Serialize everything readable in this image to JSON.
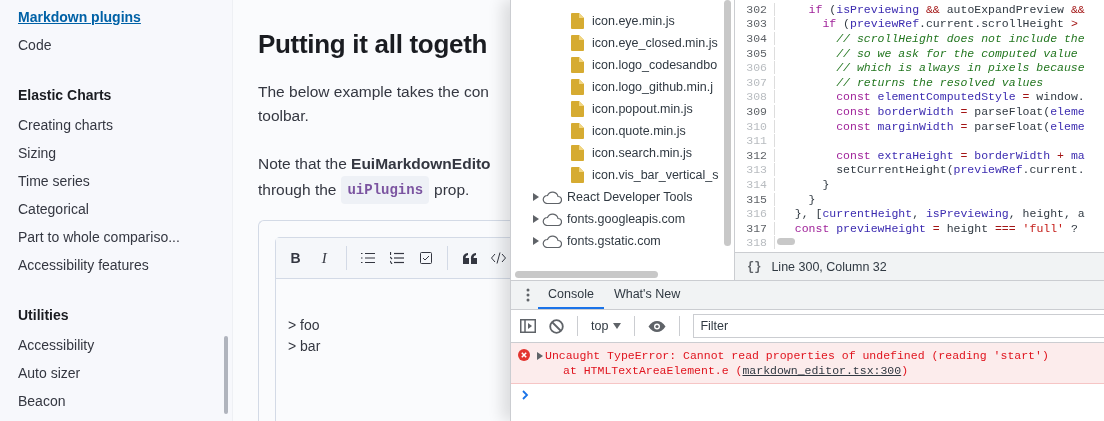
{
  "sidebar": {
    "items": [
      {
        "kind": "item",
        "label": "Markdown plugins",
        "selected": true
      },
      {
        "kind": "item",
        "label": "Code",
        "selected": false
      },
      {
        "kind": "heading",
        "label": "Elastic Charts"
      },
      {
        "kind": "item",
        "label": "Creating charts",
        "selected": false
      },
      {
        "kind": "item",
        "label": "Sizing",
        "selected": false
      },
      {
        "kind": "item",
        "label": "Time series",
        "selected": false
      },
      {
        "kind": "item",
        "label": "Categorical",
        "selected": false
      },
      {
        "kind": "item",
        "label": "Part to whole compariso...",
        "selected": false
      },
      {
        "kind": "item",
        "label": "Accessibility features",
        "selected": false
      },
      {
        "kind": "heading",
        "label": "Utilities"
      },
      {
        "kind": "item",
        "label": "Accessibility",
        "selected": false
      },
      {
        "kind": "item",
        "label": "Auto sizer",
        "selected": false
      },
      {
        "kind": "item",
        "label": "Beacon",
        "selected": false
      }
    ]
  },
  "content": {
    "title": "Putting it all togeth",
    "paragraphs": [
      [
        "The below example takes the con",
        "toolbar."
      ],
      [
        "Note that the **EuiMarkdownEdito**"
      ]
    ],
    "inline_line": {
      "before": "through the",
      "code": "uiPlugins",
      "after": "prop."
    },
    "editor": {
      "toolbar": [
        {
          "kind": "bold",
          "label": "B"
        },
        {
          "kind": "italic",
          "label": "I"
        },
        {
          "kind": "divider"
        },
        {
          "kind": "bullet"
        },
        {
          "kind": "numbered"
        },
        {
          "kind": "checkbox"
        },
        {
          "kind": "divider"
        },
        {
          "kind": "quote"
        },
        {
          "kind": "code"
        }
      ],
      "lines": [
        "> foo",
        "> bar"
      ]
    }
  },
  "devtools": {
    "file_tree": [
      {
        "kind": "file",
        "label": "icon.eye.min.js"
      },
      {
        "kind": "file",
        "label": "icon.eye_closed.min.js"
      },
      {
        "kind": "file",
        "label": "icon.logo_codesandbo"
      },
      {
        "kind": "file",
        "label": "icon.logo_github.min.j"
      },
      {
        "kind": "file",
        "label": "icon.popout.min.js"
      },
      {
        "kind": "file",
        "label": "icon.quote.min.js"
      },
      {
        "kind": "file",
        "label": "icon.search.min.js"
      },
      {
        "kind": "file",
        "label": "icon.vis_bar_vertical_s"
      },
      {
        "kind": "origin",
        "label": "React Developer Tools"
      },
      {
        "kind": "origin",
        "label": "fonts.googleapis.com"
      },
      {
        "kind": "origin",
        "label": "fonts.gstatic.com"
      }
    ],
    "code_lines": [
      {
        "number": "302",
        "dim": false,
        "tokens": [
          {
            "kind": "kw",
            "text": "    if"
          },
          {
            "kind": "plain",
            "text": " ("
          },
          {
            "kind": "var",
            "text": "isPreviewing"
          },
          {
            "kind": "op",
            "text": " &&"
          },
          {
            "kind": "plain",
            "text": " autoExpandPreview "
          },
          {
            "kind": "op",
            "text": "&&"
          }
        ]
      },
      {
        "number": "303",
        "dim": false,
        "tokens": [
          {
            "kind": "kw",
            "text": "      if"
          },
          {
            "kind": "plain",
            "text": " ("
          },
          {
            "kind": "var",
            "text": "previewRef"
          },
          {
            "kind": "plain",
            "text": ".current.scrollHeight "
          },
          {
            "kind": "op",
            "text": ">"
          }
        ]
      },
      {
        "number": "304",
        "dim": false,
        "tokens": [
          {
            "kind": "comment",
            "text": "        // scrollHeight does not include the"
          }
        ]
      },
      {
        "number": "305",
        "dim": false,
        "tokens": [
          {
            "kind": "comment",
            "text": "        // so we ask for the computed value"
          }
        ]
      },
      {
        "number": "306",
        "dim": true,
        "tokens": [
          {
            "kind": "comment",
            "text": "        // which is always in pixels because"
          }
        ]
      },
      {
        "number": "307",
        "dim": true,
        "tokens": [
          {
            "kind": "comment",
            "text": "        // returns the resolved values"
          }
        ]
      },
      {
        "number": "308",
        "dim": true,
        "tokens": [
          {
            "kind": "kw",
            "text": "        const"
          },
          {
            "kind": "var",
            "text": " elementComputedStyle"
          },
          {
            "kind": "op",
            "text": " ="
          },
          {
            "kind": "plain",
            "text": " window."
          }
        ]
      },
      {
        "number": "309",
        "dim": false,
        "tokens": [
          {
            "kind": "kw",
            "text": "        const"
          },
          {
            "kind": "var",
            "text": " borderWidth"
          },
          {
            "kind": "op",
            "text": " ="
          },
          {
            "kind": "plain",
            "text": " parseFloat("
          },
          {
            "kind": "var",
            "text": "eleme"
          }
        ]
      },
      {
        "number": "310",
        "dim": true,
        "tokens": [
          {
            "kind": "kw",
            "text": "        const"
          },
          {
            "kind": "var",
            "text": " marginWidth"
          },
          {
            "kind": "op",
            "text": " ="
          },
          {
            "kind": "plain",
            "text": " parseFloat("
          },
          {
            "kind": "var",
            "text": "eleme"
          }
        ]
      },
      {
        "number": "311",
        "dim": true
      },
      {
        "number": "312",
        "dim": false,
        "tokens": [
          {
            "kind": "kw",
            "text": "        const"
          },
          {
            "kind": "var",
            "text": " extraHeight"
          },
          {
            "kind": "op",
            "text": " ="
          },
          {
            "kind": "var",
            "text": " borderWidth"
          },
          {
            "kind": "op",
            "text": " +"
          },
          {
            "kind": "var",
            "text": " ma"
          }
        ]
      },
      {
        "number": "313",
        "dim": true,
        "tokens": [
          {
            "kind": "plain",
            "text": "        setCurrentHeight("
          },
          {
            "kind": "var",
            "text": "previewRef"
          },
          {
            "kind": "plain",
            "text": ".current."
          }
        ]
      },
      {
        "number": "314",
        "dim": true,
        "tokens": [
          {
            "kind": "plain",
            "text": "      }"
          }
        ]
      },
      {
        "number": "315",
        "dim": false,
        "tokens": [
          {
            "kind": "plain",
            "text": "    }"
          }
        ]
      },
      {
        "number": "316",
        "dim": true,
        "tokens": [
          {
            "kind": "plain",
            "text": "  }, ["
          },
          {
            "kind": "var",
            "text": "currentHeight"
          },
          {
            "kind": "plain",
            "text": ", "
          },
          {
            "kind": "var",
            "text": "isPreviewing"
          },
          {
            "kind": "plain",
            "text": ", height, a"
          }
        ]
      },
      {
        "number": "317",
        "dim": false,
        "tokens": [
          {
            "kind": "kw",
            "text": "  const"
          },
          {
            "kind": "var",
            "text": " previewHeight"
          },
          {
            "kind": "op",
            "text": " ="
          },
          {
            "kind": "plain",
            "text": " height "
          },
          {
            "kind": "op",
            "text": "==="
          },
          {
            "kind": "str",
            "text": " 'full'"
          },
          {
            "kind": "plain",
            "text": " ?"
          }
        ]
      },
      {
        "number": "318",
        "dim": true
      }
    ],
    "status_bar": {
      "format_label": "{}",
      "position": "Line 300, Column 32"
    },
    "drawer_tabs": [
      {
        "label": "Console",
        "selected": true
      },
      {
        "label": "What's New",
        "selected": false
      }
    ],
    "console_toolbar": {
      "context": "top",
      "filter": {
        "placeholder": "Filter"
      }
    },
    "messages": [
      {
        "kind": "error",
        "text": "Uncaught TypeError: Cannot read properties of undefined (reading 'start')",
        "trace_prefix": "at HTMLTextAreaElement.e (",
        "link": "markdown_editor.tsx:300",
        "trace_suffix": ")"
      }
    ]
  }
}
